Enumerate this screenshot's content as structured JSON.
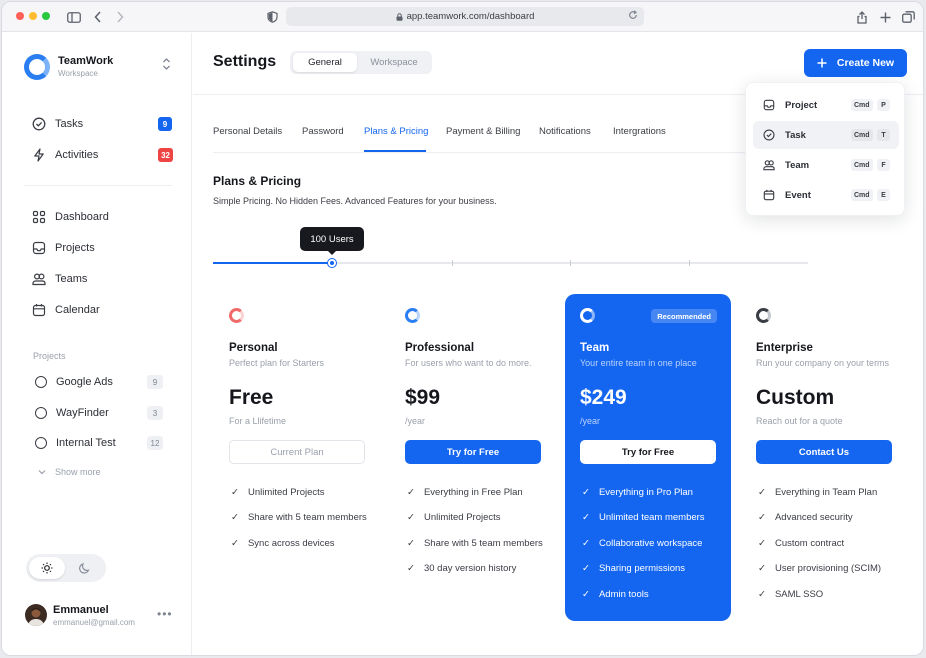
{
  "browser": {
    "url": "app.teamwork.com/dashboard"
  },
  "brand": {
    "name": "TeamWork",
    "subtitle": "Workspace"
  },
  "nav_primary": [
    {
      "label": "Tasks",
      "icon": "check-circle-icon",
      "badge": "9",
      "badge_color": "#1466f1"
    },
    {
      "label": "Activities",
      "icon": "lightning-icon",
      "badge": "32",
      "badge_color": "#ef4444"
    }
  ],
  "nav_secondary": [
    {
      "label": "Dashboard",
      "icon": "grid-icon"
    },
    {
      "label": "Projects",
      "icon": "inbox-icon"
    },
    {
      "label": "Teams",
      "icon": "users-icon"
    },
    {
      "label": "Calendar",
      "icon": "calendar-icon"
    }
  ],
  "projects": {
    "label": "Projects",
    "items": [
      {
        "label": "Google Ads",
        "count": "9"
      },
      {
        "label": "WayFinder",
        "count": "3"
      },
      {
        "label": "Internal Test",
        "count": "12"
      }
    ],
    "show_more": "Show more"
  },
  "user": {
    "name": "Emmanuel",
    "email": "emmanuel@gmail.com",
    "more": "•••"
  },
  "header": {
    "title": "Settings",
    "segments": [
      "General",
      "Workspace"
    ],
    "create_label": "Create New"
  },
  "tabs": [
    "Personal Details",
    "Password",
    "Plans & Pricing",
    "Payment & Billing",
    "Notifications",
    "Intergrations"
  ],
  "active_tab": "Plans & Pricing",
  "pricing": {
    "title": "Plans & Pricing",
    "subtitle": "Simple Pricing. No Hidden Fees. Advanced Features for your business.",
    "slider_label": "100 Users",
    "slider_fraction": 0.2
  },
  "plans": [
    {
      "name": "Personal",
      "desc": "Perfect plan for Starters",
      "price": "Free",
      "period": "For a Llifetime",
      "cta": "Current Plan",
      "icon_color": "#f06a6a",
      "features": [
        "Unlimited Projects",
        "Share with 5 team members",
        "Sync across devices"
      ]
    },
    {
      "name": "Professional",
      "desc": "For users who want to do more.",
      "price": "$99",
      "period": "/year",
      "cta": "Try for Free",
      "icon_color": "#2a7ef2",
      "features": [
        "Everything in Free Plan",
        "Unlimited Projects",
        "Share with 5 team members",
        "30 day version history"
      ]
    },
    {
      "name": "Team",
      "desc": "Your entire team in one place",
      "price": "$249",
      "period": "/year",
      "cta": "Try for Free",
      "badge": "Recommended",
      "icon_color": "#ffffff",
      "features": [
        "Everything in Pro Plan",
        "Unlimited team members",
        "Collaborative workspace",
        "Sharing permissions",
        "Admin tools"
      ]
    },
    {
      "name": "Enterprise",
      "desc": "Run your company on your terms",
      "price": "Custom",
      "period": "Reach out for a quote",
      "cta": "Contact Us",
      "icon_color": "#3a3d44",
      "features": [
        "Everything in Team Plan",
        "Advanced security",
        "Custom contract",
        "User provisioning (SCIM)",
        "SAML SSO"
      ]
    }
  ],
  "create_menu": [
    {
      "label": "Project",
      "icon": "inbox-icon",
      "mod": "Cmd",
      "key": "P"
    },
    {
      "label": "Task",
      "icon": "check-circle-icon",
      "mod": "Cmd",
      "key": "T"
    },
    {
      "label": "Team",
      "icon": "users-icon",
      "mod": "Cmd",
      "key": "F"
    },
    {
      "label": "Event",
      "icon": "calendar-icon",
      "mod": "Cmd",
      "key": "E"
    }
  ],
  "colors": {
    "accent": "#1466f1",
    "danger": "#ef4444"
  }
}
